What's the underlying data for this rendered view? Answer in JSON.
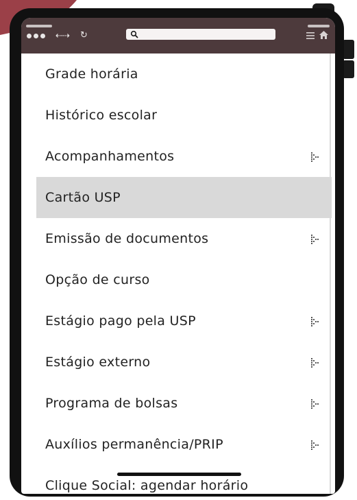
{
  "colors": {
    "backdrop_accent": "#9b4048",
    "device_frame": "#111111",
    "browser_bar": "#4d3a3c",
    "active_item_bg": "#d9d9d9",
    "text": "#222222"
  },
  "browser": {
    "window_controls_icon": "dots-icon",
    "back_forward_icon": "back-forward-arrows-icon",
    "back_forward_glyph": "⇠⇢",
    "reload_icon": "reload-icon",
    "reload_glyph": "↻",
    "address_icon": "search-icon",
    "menu_icon": "hamburger-menu-icon",
    "home_icon": "home-icon"
  },
  "menu": {
    "items": [
      {
        "label": "Grade horária",
        "has_submenu": false,
        "active": false
      },
      {
        "label": "Histórico escolar",
        "has_submenu": false,
        "active": false
      },
      {
        "label": "Acompanhamentos",
        "has_submenu": true,
        "active": false
      },
      {
        "label": "Cartão USP",
        "has_submenu": false,
        "active": true
      },
      {
        "label": "Emissão de documentos",
        "has_submenu": true,
        "active": false
      },
      {
        "label": "Opção de curso",
        "has_submenu": false,
        "active": false
      },
      {
        "label": "Estágio pago pela USP",
        "has_submenu": true,
        "active": false
      },
      {
        "label": "Estágio externo",
        "has_submenu": true,
        "active": false
      },
      {
        "label": "Programa de bolsas",
        "has_submenu": true,
        "active": false
      },
      {
        "label": "Auxílios permanência/PRIP",
        "has_submenu": true,
        "active": false
      },
      {
        "label": "Clique Social: agendar horário",
        "has_submenu": false,
        "active": false
      }
    ]
  }
}
